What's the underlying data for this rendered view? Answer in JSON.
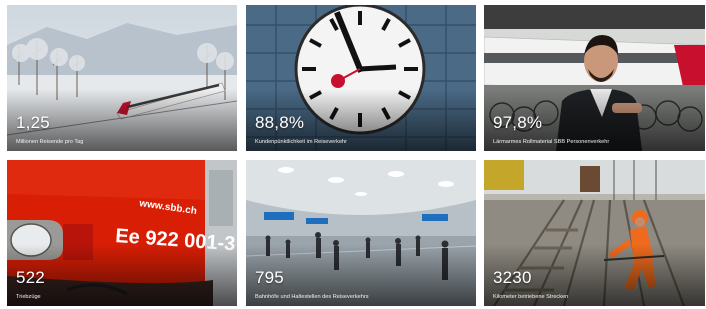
{
  "tiles": [
    {
      "value": "1,25",
      "caption": "Millionen Reisende pro Tag",
      "scene": "snowy-train-landscape"
    },
    {
      "value": "88,8%",
      "caption": "Kundenpünktlichkeit im Reiseverkehr",
      "scene": "station-clock"
    },
    {
      "value": "97,8%",
      "caption": "Lärmarmes Rollmaterial SBB Personenverkehr",
      "scene": "man-with-bicycles-and-train"
    },
    {
      "value": "522",
      "caption": "Triebzüge",
      "scene": "red-locomotive"
    },
    {
      "value": "795",
      "caption": "Bahnhöfe und Haltestellen des Reiseverkehrs",
      "scene": "station-concourse"
    },
    {
      "value": "3230",
      "caption": "Kilometer betriebene Strecken",
      "scene": "track-worker"
    }
  ],
  "locomotive": {
    "brand_text": "www.sbb.ch",
    "number_text": "Ee 922 001-3"
  },
  "colors": {
    "sbb_red": "#d81e05",
    "worker_orange": "#ef6a1d"
  }
}
